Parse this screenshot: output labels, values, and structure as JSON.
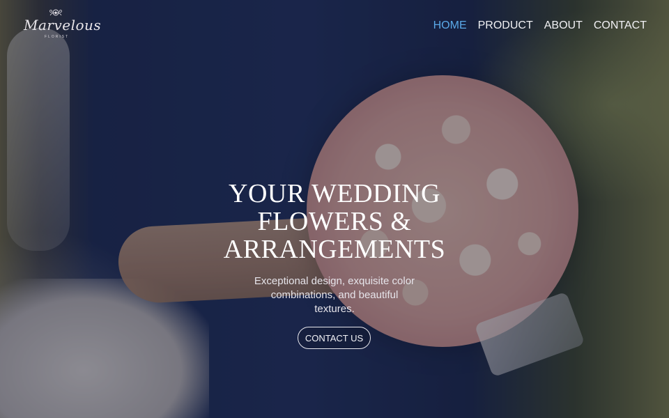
{
  "brand": {
    "logo_script": "Marvelous",
    "logo_sub": "FLORIST",
    "icon": "flower-icon"
  },
  "nav": {
    "items": [
      {
        "label": "HOME",
        "active": true
      },
      {
        "label": "PRODUCT",
        "active": false
      },
      {
        "label": "ABOUT",
        "active": false
      },
      {
        "label": "CONTACT",
        "active": false
      }
    ],
    "active_color": "#5aa9e8"
  },
  "hero": {
    "headline": "YOUR WEDDING FLOWERS & ARRANGEMENTS",
    "subtext": "Exceptional design, exquisite color combinations, and beautiful textures.",
    "cta_label": "CONTACT US"
  }
}
